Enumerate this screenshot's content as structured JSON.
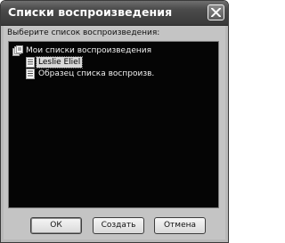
{
  "window": {
    "title": "Списки воспроизведения"
  },
  "dialog": {
    "prompt": "Выберите список воспроизведения:",
    "tree": {
      "root": {
        "label": "Мои списки воспроизведения",
        "icon": "playlist-folder-icon"
      },
      "items": [
        {
          "label": "Leslie Eliel",
          "icon": "playlist-icon",
          "selected": true
        },
        {
          "label": "Образец списка воспроизв.",
          "icon": "playlist-icon",
          "selected": false
        }
      ]
    }
  },
  "buttons": {
    "ok": "ОК",
    "create": "Создать",
    "cancel": "Отмена"
  },
  "colors": {
    "titlebar": "#3a3a3a",
    "listbox_bg": "#050505",
    "dialog_bg": "#c4c4c4",
    "selection_bg": "#d8d8d8"
  }
}
